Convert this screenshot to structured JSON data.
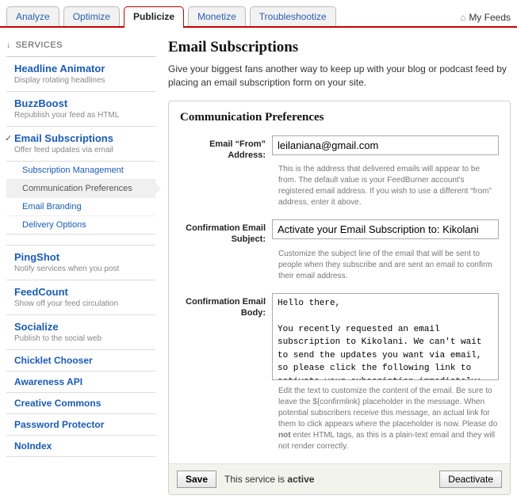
{
  "tabs": [
    "Analyze",
    "Optimize",
    "Publicize",
    "Monetize",
    "Troubleshootize"
  ],
  "active_tab_index": 2,
  "my_feeds": "My Feeds",
  "sidebar": {
    "header": "SERVICES",
    "items": [
      {
        "title": "Headline Animator",
        "desc": "Display rotating headlines"
      },
      {
        "title": "BuzzBoost",
        "desc": "Republish your feed as HTML"
      },
      {
        "title": "Email Subscriptions",
        "desc": "Offer feed updates via email",
        "checked": true,
        "subs": [
          "Subscription Management",
          "Communication Preferences",
          "Email Branding",
          "Delivery Options"
        ],
        "active_sub_index": 1
      },
      {
        "title": "PingShot",
        "desc": "Notify services when you post"
      },
      {
        "title": "FeedCount",
        "desc": "Show off your feed circulation"
      },
      {
        "title": "Socialize",
        "desc": "Publish to the social web"
      },
      {
        "title": "Chicklet Chooser"
      },
      {
        "title": "Awareness API"
      },
      {
        "title": "Creative Commons"
      },
      {
        "title": "Password Protector"
      },
      {
        "title": "NoIndex"
      }
    ]
  },
  "page": {
    "title": "Email Subscriptions",
    "intro": "Give your biggest fans another way to keep up with your blog or podcast feed by placing an email subscription form on your site."
  },
  "panel": {
    "title": "Communication Preferences",
    "from_label": "Email “From” Address:",
    "from_value": "leilaniana@gmail.com",
    "from_help": "This is the address that delivered emails will appear to be from. The default value is your FeedBurner account's registered email address. If you wish to use a different “from” address, enter it above.",
    "subject_label": "Confirmation Email Subject:",
    "subject_value": "Activate your Email Subscription to: Kikolani",
    "subject_help": "Customize the subject line of the email that will be sent to people when they subscribe and are sent an email to confirm their email address.",
    "body_label": "Confirmation Email Body:",
    "body_value": "Hello there,\n\nYou recently requested an email subscription to Kikolani. We can't wait to send the updates you want via email, so please click the following link to activate your subscription immediately:",
    "body_help_pre": "Edit the text to customize the content of the email. Be sure to leave the ${confirmlink} placeholder in the message. When potential subscribers receive this message, an actual link for them to click appears where the placeholder is now. Please do ",
    "body_help_bold": "not",
    "body_help_post": " enter HTML tags, as this is a plain-text email and they will not render correctly."
  },
  "footer": {
    "save": "Save",
    "status_pre": "This service is ",
    "status_bold": "active",
    "deactivate": "Deactivate"
  }
}
